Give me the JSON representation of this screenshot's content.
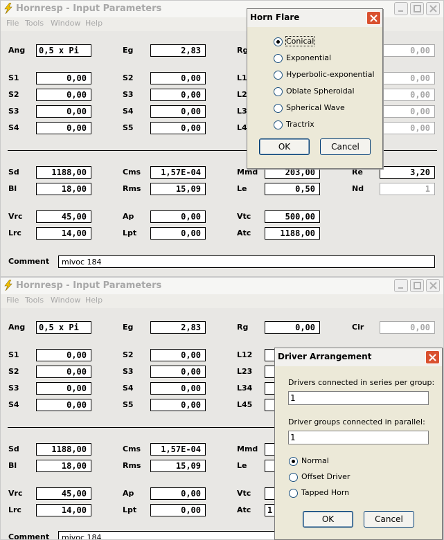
{
  "window_top": {
    "title": "Hornresp - Input Parameters",
    "menu": [
      "File",
      "Tools",
      "Window",
      "Help"
    ],
    "labels": {
      "ang": "Ang",
      "eg": "Eg",
      "rg": "Rg",
      "s1": "S1",
      "s2": "S2",
      "s3": "S3",
      "s4": "S4",
      "s5": "S5",
      "s2b": "S2",
      "s3b": "S3",
      "s4b": "S4",
      "l1": "L1",
      "l2": "L2",
      "l3": "L3",
      "l4": "L4",
      "sd": "Sd",
      "bl": "Bl",
      "cms": "Cms",
      "rms": "Rms",
      "mmd": "Mmd",
      "le": "Le",
      "re": "Re",
      "nd": "Nd",
      "vrc": "Vrc",
      "lrc": "Lrc",
      "ap": "Ap",
      "lpt": "Lpt",
      "vtc": "Vtc",
      "atc": "Atc",
      "comment": "Comment"
    },
    "values": {
      "ang": "0,5 x Pi",
      "eg": "2,83",
      "rg": "0,00",
      "s1": "0,00",
      "s2": "0,00",
      "s3": "0,00",
      "s4": "0,00",
      "s2b": "0,00",
      "s3b": "0,00",
      "s4b": "0,00",
      "s5": "0,00",
      "l1": "0,00",
      "l2": "0,00",
      "l3": "0,00",
      "l4": "0,00",
      "sd": "1188,00",
      "bl": "18,00",
      "cms": "1,57E-04",
      "rms": "15,09",
      "mmd": "203,00",
      "le": "0,50",
      "re": "3,20",
      "nd": "1",
      "vrc": "45,00",
      "lrc": "14,00",
      "ap": "0,00",
      "lpt": "0,00",
      "vtc": "500,00",
      "atc": "1188,00",
      "comment": "mivoc 184"
    }
  },
  "horn_flare_dialog": {
    "title": "Horn Flare",
    "options": [
      "Conical",
      "Exponential",
      "Hyperbolic-exponential",
      "Oblate Spheroidal",
      "Spherical Wave",
      "Tractrix"
    ],
    "selected": "Conical",
    "ok_label": "OK",
    "cancel_label": "Cancel"
  },
  "window_bottom": {
    "title": "Hornresp - Input Parameters",
    "menu": [
      "File",
      "Tools",
      "Window",
      "Help"
    ],
    "labels": {
      "ang": "Ang",
      "eg": "Eg",
      "rg": "Rg",
      "cir": "Cir",
      "s1": "S1",
      "s2": "S2",
      "s3": "S3",
      "s4": "S4",
      "s5": "S5",
      "s2b": "S2",
      "s3b": "S3",
      "s4b": "S4",
      "l12": "L12",
      "l23": "L23",
      "l34": "L34",
      "l45": "L45",
      "sd": "Sd",
      "bl": "Bl",
      "cms": "Cms",
      "rms": "Rms",
      "mmd": "Mmd",
      "le": "Le",
      "vrc": "Vrc",
      "lrc": "Lrc",
      "ap": "Ap",
      "lpt": "Lpt",
      "vtc": "Vtc",
      "atc": "Atc",
      "comment": "Comment"
    },
    "values": {
      "ang": "0,5 x Pi",
      "eg": "2,83",
      "rg": "0,00",
      "cir": "0,00",
      "s1": "0,00",
      "s2": "0,00",
      "s3": "0,00",
      "s4": "0,00",
      "s2b": "0,00",
      "s3b": "0,00",
      "s4b": "0,00",
      "s5": "0,00",
      "sd": "1188,00",
      "bl": "18,00",
      "cms": "1,57E-04",
      "rms": "15,09",
      "vrc": "45,00",
      "lrc": "14,00",
      "ap": "0,00",
      "lpt": "0,00",
      "atc_partial": "1",
      "comment": "mivoc 184"
    }
  },
  "driver_dialog": {
    "title": "Driver Arrangement",
    "series_label": "Drivers connected in series per group:",
    "series_value": "1",
    "parallel_label": "Driver groups connected in parallel:",
    "parallel_value": "1",
    "options": [
      "Normal",
      "Offset Driver",
      "Tapped Horn"
    ],
    "selected": "Normal",
    "ok_label": "OK",
    "cancel_label": "Cancel"
  },
  "colors": {
    "window_bg": "#e8e7e4",
    "disabled_text": "#a8a8a8",
    "dialog_bg": "#ece9d8",
    "close_red": "#d9502e"
  }
}
